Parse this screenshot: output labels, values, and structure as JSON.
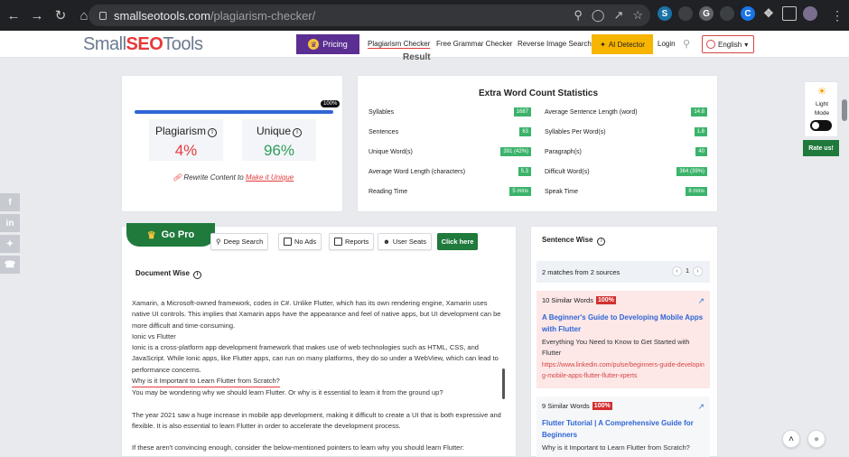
{
  "browser": {
    "url_domain": "smallseotools.com",
    "url_path": "/plagiarism-checker/"
  },
  "header": {
    "logo_left": "Small",
    "logo_accent": "SEO",
    "logo_right": "Tools",
    "pricing": "Pricing",
    "nav": [
      "Plagiarism Checker",
      "Free Grammar Checker",
      "Reverse Image Search"
    ],
    "ai_detector": "AI Detector",
    "login": "Login",
    "language": "English",
    "result_peek": "Result"
  },
  "summary": {
    "progress_label": "100%",
    "progress_value": 100,
    "plagiarism_label": "Plagiarism",
    "plagiarism_value": "4%",
    "unique_label": "Unique",
    "unique_value": "96%",
    "rewrite_prefix": "Rewrite Content to",
    "rewrite_link": "Make it Unique"
  },
  "extra_stats": {
    "title": "Extra Word Count Statistics",
    "left": [
      {
        "label": "Syllables",
        "value": "1687"
      },
      {
        "label": "Sentences",
        "value": "63"
      },
      {
        "label": "Unique Word(s)",
        "value": "391 (42%)"
      },
      {
        "label": "Average Word Length (characters)",
        "value": "5.3"
      },
      {
        "label": "Reading Time",
        "value": "5 mins"
      }
    ],
    "right": [
      {
        "label": "Average Sentence Length (word)",
        "value": "14.8"
      },
      {
        "label": "Syllables Per Word(s)",
        "value": "1.8"
      },
      {
        "label": "Paragraph(s)",
        "value": "40"
      },
      {
        "label": "Difficult Word(s)",
        "value": "364 (39%)"
      },
      {
        "label": "Speak Time",
        "value": "8 mins"
      }
    ]
  },
  "gopro": {
    "title": "Go Pro",
    "features": [
      "Deep Search",
      "No Ads",
      "Reports",
      "User Seats"
    ],
    "cta": "Click here"
  },
  "document": {
    "title": "Document Wise",
    "lines": [
      "Xamarin, a Microsoft-owned framework, codes in C#. Unlike Flutter, which has its own rendering engine, Xamarin uses native UI controls. This implies that Xamarin apps have the appearance and feel of native apps, but UI development can be more difficult and time-consuming.",
      "Ionic vs Flutter",
      "Ionic is a cross-platform app development framework that makes use of web technologies such as HTML, CSS, and JavaScript. While Ionic apps, like Flutter apps, can run on many platforms, they do so under a WebView, which can lead to performance concerns.",
      "Why is it Important to Learn Flutter from Scratch?",
      "You may be wondering why we should learn Flutter. Or why is it essential to learn it from the ground up?",
      "",
      "The year 2021 saw a huge increase in mobile app development, making it difficult to create a UI that is both expressive and flexible. It is also essential to learn Flutter in order to accelerate the development process.",
      "",
      "If these aren't convincing enough, consider the below-mentioned pointers to learn why you should learn Flutter:"
    ]
  },
  "sentence_wise": {
    "title": "Sentence Wise",
    "matches": "2 matches from 2 sources",
    "page": "1",
    "sources": [
      {
        "similar": "10 Similar Words",
        "percent": "100%",
        "title": "A Beginner's Guide to Developing Mobile Apps with Flutter",
        "desc": "Everything You Need to Know to Get Started with Flutter",
        "url": "https://www.linkedin.com/pulse/beginners-guide-developing-mobile-apps-flutter-flutter-xperts"
      },
      {
        "similar": "9 Similar Words",
        "percent": "100%",
        "title": "Flutter Tutorial | A Comprehensive Guide for Beginners",
        "desc": "Why is it Important to Learn Flutter from Scratch?",
        "url": ""
      }
    ]
  },
  "widgets": {
    "light_label": "Light",
    "mode_label": "Mode",
    "rate_us": "Rate us!"
  },
  "colors": {
    "plagiarism": "#e53b3b",
    "unique": "#2e9e5b",
    "brand_green": "#1f7a3c",
    "brand_purple": "#5b2e91"
  }
}
